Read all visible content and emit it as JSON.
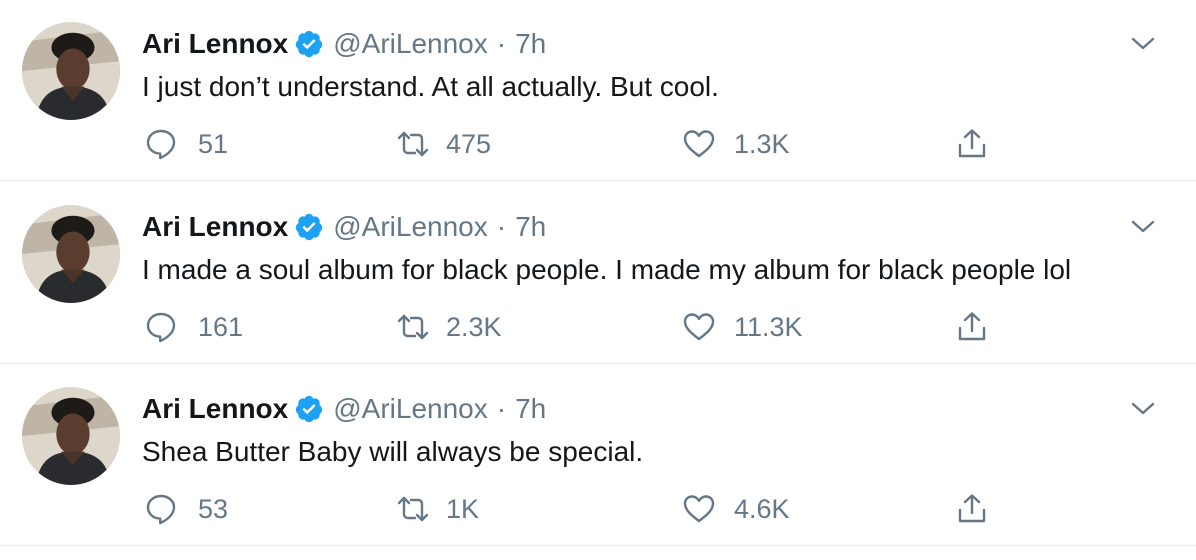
{
  "colors": {
    "verified": "#1da1f2",
    "secondary_text": "#657786",
    "primary_text": "#14171a",
    "divider": "#e6ecf0"
  },
  "icons": {
    "verified": "verified-badge-icon",
    "caret": "chevron-down-icon",
    "reply": "reply-bubble-icon",
    "retweet": "retweet-icon",
    "like": "heart-icon",
    "share": "share-upload-icon"
  },
  "tweets": [
    {
      "name": "Ari Lennox",
      "handle": "@AriLennox",
      "separator": "·",
      "time": "7h",
      "text": "I just don’t understand. At all actually. But cool.",
      "replies": "51",
      "retweets": "475",
      "likes": "1.3K"
    },
    {
      "name": "Ari Lennox",
      "handle": "@AriLennox",
      "separator": "·",
      "time": "7h",
      "text": "I made a soul album for black people. I made my album for black people lol",
      "replies": "161",
      "retweets": "2.3K",
      "likes": "11.3K"
    },
    {
      "name": "Ari Lennox",
      "handle": "@AriLennox",
      "separator": "·",
      "time": "7h",
      "text": "Shea Butter Baby will always be special.",
      "replies": "53",
      "retweets": "1K",
      "likes": "4.6K"
    }
  ]
}
